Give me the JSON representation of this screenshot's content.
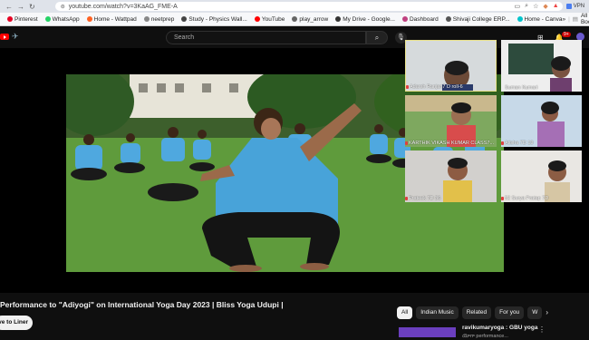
{
  "browser": {
    "url": "youtube.com/watch?v=3KaAG_FME-A",
    "vpn_label": "VPN"
  },
  "bookmarks": {
    "items": [
      {
        "label": "Pinterest",
        "color": "#e60023"
      },
      {
        "label": "WhatsApp",
        "color": "#25d366"
      },
      {
        "label": "Home - Wattpad",
        "color": "#ff6122"
      },
      {
        "label": "neetprep",
        "color": "#888888"
      },
      {
        "label": "Study - Physics Wall...",
        "color": "#444444"
      },
      {
        "label": "YouTube",
        "color": "#ff0000"
      },
      {
        "label": "play_arrow",
        "color": "#666666"
      },
      {
        "label": "My Drive - Google...",
        "color": "#333333"
      },
      {
        "label": "Dashboard",
        "color": "#c04080"
      },
      {
        "label": "Shivaji College ERP...",
        "color": "#555555"
      },
      {
        "label": "Home - Canva",
        "color": "#00c4cc"
      }
    ],
    "more": "»",
    "all_bookmarks": "All Bookm"
  },
  "youtube": {
    "search_placeholder": "Search",
    "notification_count": "9+",
    "video_title": "Performance to \"Adiyogi\" on International Yoga Day 2023 | Bliss Yoga Udupi |",
    "save_button": "ve to Liner",
    "chips": [
      "All",
      "Indian Music",
      "Related",
      "For you",
      "W"
    ],
    "recommendation": {
      "title": "ravikumaryoga : GBU yoga",
      "subtitle": "యోగా performance..."
    }
  },
  "meeting": {
    "participants": [
      {
        "name": "Adarsh Ranjan7 D roll-6"
      },
      {
        "name": "Suman Kumari"
      },
      {
        "name": "KARTHIK VIKASH KUMAR CLASS7..."
      },
      {
        "name": "Atisha 7D 19"
      },
      {
        "name": "Prateek 7D 36"
      },
      {
        "name": "52 Surya Pratap 7D"
      }
    ]
  }
}
